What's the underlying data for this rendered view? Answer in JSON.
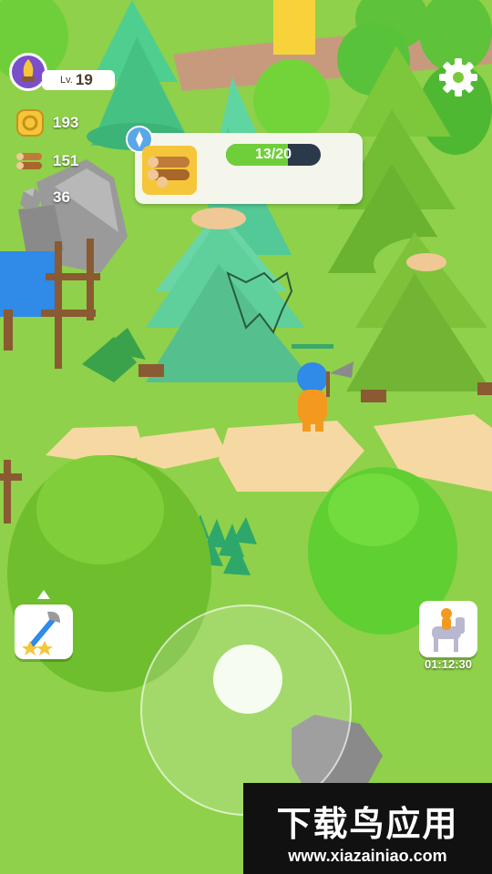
{
  "player": {
    "level_prefix": "Lv.",
    "level": "19"
  },
  "resources": [
    {
      "name": "coins",
      "icon": "coin-icon",
      "value": "193"
    },
    {
      "name": "wood",
      "icon": "log-icon",
      "value": "151"
    },
    {
      "name": "stone",
      "icon": "stone-icon",
      "value": "36"
    }
  ],
  "task": {
    "icon": "log-bundle-icon",
    "progress_text": "13/20",
    "current": 13,
    "goal": 20
  },
  "mount": {
    "timer": "01:12:30"
  },
  "watermark": {
    "title": "下载鸟应用",
    "url": "www.xiazainiao.com"
  },
  "colors": {
    "grass": "#8fd14a",
    "path": "#f6d9a2",
    "progress": "#6fcf3a",
    "accent": "#f5c63a"
  }
}
